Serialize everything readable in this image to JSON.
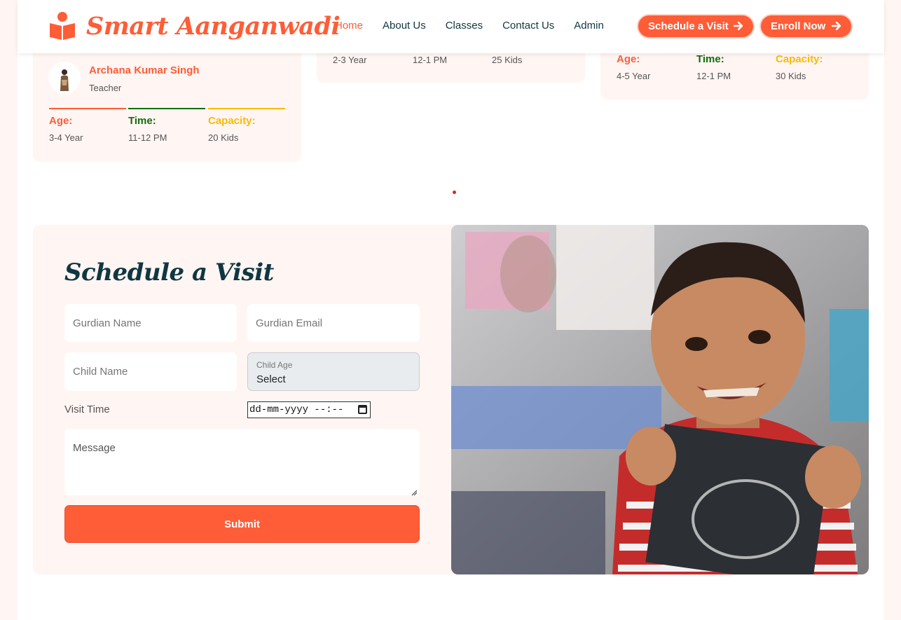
{
  "brand": {
    "name": "Smart Aanganwadi",
    "icon": "book-reader-icon"
  },
  "nav": {
    "items": [
      {
        "label": "Home",
        "active": true
      },
      {
        "label": "About Us",
        "active": false
      },
      {
        "label": "Classes",
        "active": false
      },
      {
        "label": "Contact Us",
        "active": false
      },
      {
        "label": "Admin",
        "active": false
      }
    ]
  },
  "header_buttons": {
    "schedule": {
      "label": "Schedule a Visit",
      "icon": "arrow-right-icon"
    },
    "enroll": {
      "label": "Enroll Now",
      "icon": "arrow-right-icon"
    }
  },
  "classes": [
    {
      "teacher": "Archana Kumar Singh",
      "role": "Teacher",
      "age_label": "Age:",
      "age": "3-4 Year",
      "time_label": "Time:",
      "time": "11-12 PM",
      "capacity_label": "Capacity:",
      "capacity": "20 Kids"
    },
    {
      "age": "2-3 Year",
      "time": "12-1 PM",
      "capacity": "25 Kids"
    },
    {
      "age_label": "Age:",
      "age": "4-5 Year",
      "time_label": "Time:",
      "time": "12-1 PM",
      "capacity_label": "Capacity:",
      "capacity": "30 Kids"
    }
  ],
  "colors": {
    "accent": "#fe5d37",
    "green": "#126d0c",
    "yellow": "#fcba04",
    "dark": "#103741",
    "light_bg": "#fff5f3"
  },
  "visit_form": {
    "title": "Schedule a Visit",
    "guardian_name_placeholder": "Gurdian Name",
    "guardian_email_placeholder": "Gurdian Email",
    "child_name_placeholder": "Child Name",
    "child_age_label": "Child Age",
    "child_age_value": "Select",
    "visit_time_label": "Visit Time",
    "visit_time_value": "dd-mm-yyyy --:--",
    "message_placeholder": "Message",
    "submit_label": "Submit"
  }
}
